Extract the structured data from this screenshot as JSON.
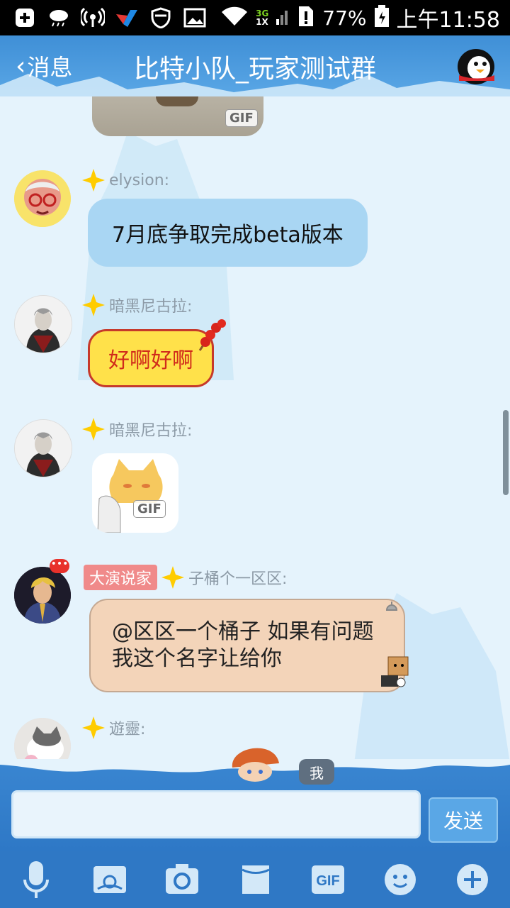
{
  "status_bar": {
    "icons": [
      "add-icon",
      "weather-icon",
      "hotspot-icon",
      "app-icon",
      "shield-icon",
      "image-icon"
    ],
    "network_top": "3G",
    "network_bottom": "1X",
    "battery_percent": "77%",
    "time": "上午11:58"
  },
  "header": {
    "back_label": "消息",
    "title": "比特小队_玩家测试群"
  },
  "messages": [
    {
      "type": "gif",
      "sender": "",
      "gif_label": "GIF"
    },
    {
      "type": "text",
      "sender": "elysion:",
      "text": "7月底争取完成beta版本"
    },
    {
      "type": "text",
      "sender": "暗黑尼古拉:",
      "text": "好啊好啊"
    },
    {
      "type": "gif",
      "sender": "暗黑尼古拉:",
      "gif_label": "GIF"
    },
    {
      "type": "text",
      "sender": "子桶个一区区:",
      "badge": "大演说家",
      "text_line1": "@区区一个桶子 如果有问题",
      "text_line2": "我这个名字让给你"
    },
    {
      "type": "partial",
      "sender": "遊靈:"
    }
  ],
  "composer": {
    "me_label": "我",
    "send_label": "发送"
  },
  "toolbar": {
    "items": [
      "microphone-icon",
      "theme-icon",
      "camera-icon",
      "folder-icon",
      "gif-icon",
      "emoji-icon",
      "plus-icon"
    ],
    "gif_text": "GIF"
  },
  "colors": {
    "header": "#4a99dd",
    "chat_bg": "#e5f3fc",
    "blue_bubble": "#a9d6f3",
    "yellow_bubble": "#ffe14a",
    "peach_bubble": "#f3d4b9",
    "toolbar": "#2f78c5"
  }
}
